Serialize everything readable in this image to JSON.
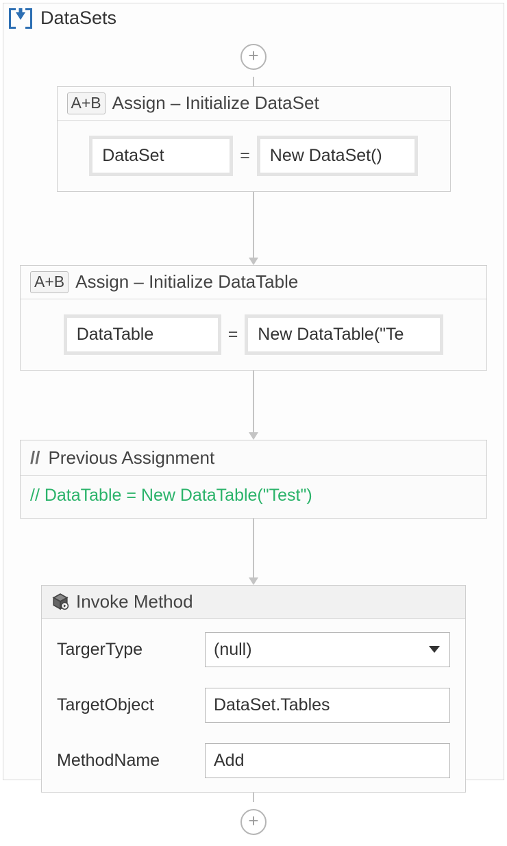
{
  "sequence": {
    "title": "DataSets"
  },
  "activities": [
    {
      "type": "Assign",
      "tag": "A+B",
      "title": "Assign – Initialize DataSet",
      "to": "DataSet",
      "op": "=",
      "value": "New DataSet()"
    },
    {
      "type": "Assign",
      "tag": "A+B",
      "title": "Assign – Initialize DataTable",
      "to": "DataTable",
      "op": "=",
      "value": "New DataTable(\"Te"
    },
    {
      "type": "Comment",
      "icon": "//",
      "title": "Previous Assignment",
      "text": "// DataTable = New DataTable(\"Test\")"
    },
    {
      "type": "InvokeMethod",
      "title": "Invoke Method",
      "fields": [
        {
          "label": "TargerType",
          "value": "(null)"
        },
        {
          "label": "TargetObject",
          "value": "DataSet.Tables"
        },
        {
          "label": "MethodName",
          "value": "Add"
        }
      ]
    }
  ]
}
